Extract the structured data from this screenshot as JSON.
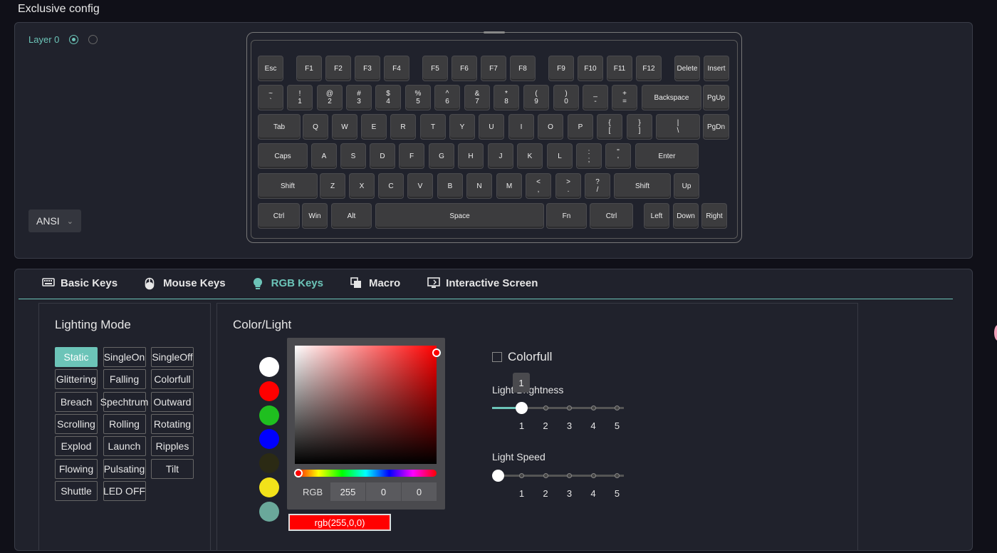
{
  "page_title": "Exclusive config",
  "layer": {
    "label": "Layer 0"
  },
  "layout_select": {
    "value": "ANSI"
  },
  "keyboard_rows": [
    [
      "Esc",
      "F1",
      "F2",
      "F3",
      "F4",
      "F5",
      "F6",
      "F7",
      "F8",
      "F9",
      "F10",
      "F11",
      "F12",
      "Delete",
      "Insert"
    ],
    [
      [
        "~",
        "`"
      ],
      [
        "!",
        "1"
      ],
      [
        "@",
        "2"
      ],
      [
        "#",
        "3"
      ],
      [
        "$",
        "4"
      ],
      [
        "%",
        "5"
      ],
      [
        "^",
        "6"
      ],
      [
        "&",
        "7"
      ],
      [
        "*",
        "8"
      ],
      [
        "(",
        "9"
      ],
      [
        ")",
        "0"
      ],
      [
        "_",
        "-"
      ],
      [
        "+",
        "="
      ],
      "Backspace",
      "PgUp"
    ],
    [
      "Tab",
      "Q",
      "W",
      "E",
      "R",
      "T",
      "Y",
      "U",
      "I",
      "O",
      "P",
      [
        "{",
        "["
      ],
      [
        "}",
        "]"
      ],
      [
        "|",
        "\\"
      ],
      "PgDn"
    ],
    [
      "Caps",
      "A",
      "S",
      "D",
      "F",
      "G",
      "H",
      "J",
      "K",
      "L",
      [
        ":",
        ";"
      ],
      [
        "\"",
        "'"
      ],
      "Enter"
    ],
    [
      "Shift",
      "Z",
      "X",
      "C",
      "V",
      "B",
      "N",
      "M",
      [
        "<",
        ","
      ],
      [
        ">",
        "."
      ],
      [
        "?",
        "/"
      ],
      "Shift",
      "Up"
    ],
    [
      "Ctrl",
      "Win",
      "Alt",
      "Space",
      "Fn",
      "Ctrl",
      "Left",
      "Down",
      "Right"
    ]
  ],
  "tabs": [
    {
      "label": "Basic Keys",
      "icon": "keyboard-icon",
      "active": false
    },
    {
      "label": "Mouse Keys",
      "icon": "mouse-icon",
      "active": false
    },
    {
      "label": "RGB Keys",
      "icon": "bulb-icon",
      "active": true
    },
    {
      "label": "Macro",
      "icon": "macro-icon",
      "active": false
    },
    {
      "label": "Interactive Screen",
      "icon": "screen-icon",
      "active": false
    }
  ],
  "lighting": {
    "title": "Lighting Mode",
    "modes": [
      "Static",
      "SingleOn",
      "SingleOff",
      "Glittering",
      "Falling",
      "Colorfull",
      "Breach",
      "Spechtrum",
      "Outward",
      "Scrolling",
      "Rolling",
      "Rotating",
      "Explod",
      "Launch",
      "Ripples",
      "Flowing",
      "Pulsating",
      "Tilt",
      "Shuttle",
      "LED OFF"
    ],
    "active": "Static"
  },
  "color": {
    "title": "Color/Light",
    "swatches": [
      "#ffffff",
      "#ff0000",
      "#1fbf1f",
      "#0000ff",
      "#2b2a14",
      "#f2e21a",
      "#6aa89a"
    ],
    "rgb_label": "RGB",
    "r": "255",
    "g": "0",
    "b": "0",
    "output": "rgb(255,0,0)",
    "accent": "#6cc4b8"
  },
  "colorfull": {
    "label": "Colorfull",
    "checked": false
  },
  "brightness": {
    "label": "Light Brightness",
    "value": 1,
    "tooltip": "1",
    "ticks": [
      "1",
      "2",
      "3",
      "4",
      "5"
    ]
  },
  "speed": {
    "label": "Light Speed",
    "value": 1,
    "ticks": [
      "1",
      "2",
      "3",
      "4",
      "5"
    ]
  }
}
